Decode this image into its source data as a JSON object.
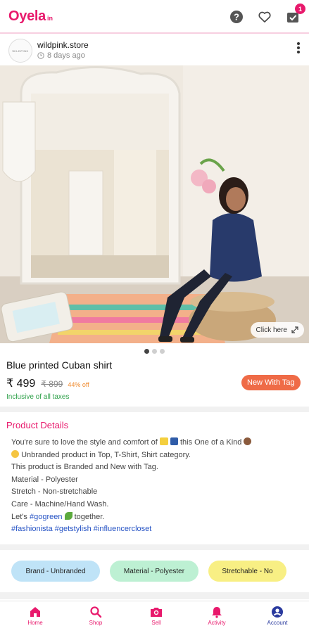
{
  "app": {
    "logo_main": "Oyela",
    "logo_suffix": "in",
    "cart_badge": "1",
    "colors": {
      "brand": "#e8196c",
      "accent": "#ef6b47",
      "hashtag": "#2754c5",
      "success": "#2fa14a"
    }
  },
  "icons": {
    "help": "help-icon",
    "wishlist": "heart-icon",
    "cart": "cart-check-icon",
    "more": "more-vertical-icon",
    "clock": "clock-icon",
    "expand": "expand-icon"
  },
  "post": {
    "store_name": "wildpink.store",
    "posted_ago": "8 days ago",
    "avatar_text": "WILDPINK",
    "click_here": "Click here",
    "carousel": {
      "count": 3,
      "active": 0
    }
  },
  "product": {
    "title": "Blue printed Cuban shirt",
    "price": "₹ 499",
    "mrp": "₹ 899",
    "discount": "44% off",
    "tag_button": "New With Tag",
    "taxes_note": "Inclusive of all taxes"
  },
  "details": {
    "heading": "Product Details",
    "line1_a": "You're sure to love the style and comfort of",
    "line1_b": "this One of a Kind",
    "line2": "Unbranded product in Top, T-Shirt, Shirt category.",
    "line3": "This product is Branded and New with Tag.",
    "line4": "Material - Polyester",
    "line5": "Stretch - Non-stretchable",
    "line6": "Care - Machine/Hand Wash.",
    "line7_a": "Let's",
    "line7_tag": "#gogreen",
    "line7_b": "together.",
    "hashtags": "#fashionista #getstylish #influencercloset"
  },
  "chips": [
    {
      "label": "Brand - Unbranded",
      "color": "#bfe3f7"
    },
    {
      "label": "Material - Polyester",
      "color": "#bdf0d3"
    },
    {
      "label": "Stretchable - No",
      "color": "#f8ef84"
    }
  ],
  "nav": {
    "home": "Home",
    "shop": "Shop",
    "sell": "Sell",
    "activity": "Activity",
    "account": "Account"
  }
}
